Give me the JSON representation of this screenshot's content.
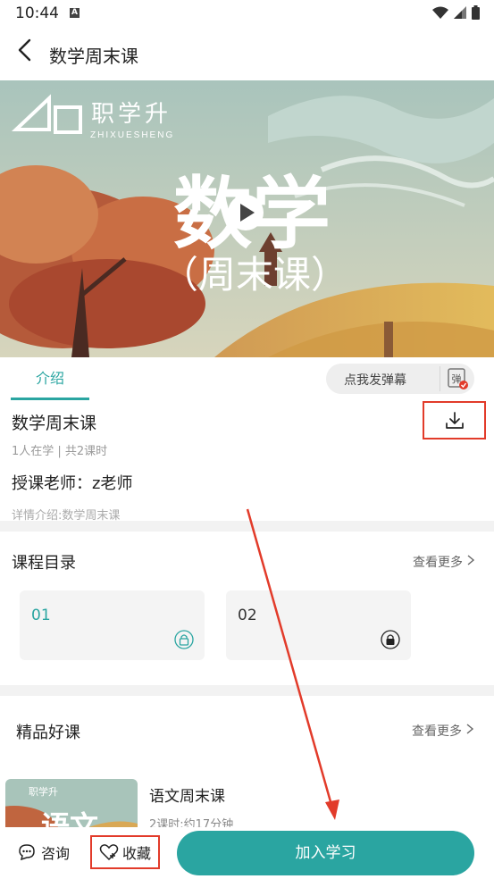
{
  "status_bar": {
    "time": "10:44",
    "notification_letter": "A"
  },
  "header": {
    "title": "数学周末课"
  },
  "banner": {
    "brand_name": "职学升",
    "brand_pinyin": "ZHIXUESHENG",
    "main_title": "数学",
    "sub_title": "（周末课）"
  },
  "tabs": {
    "intro_label": "介绍",
    "danmu_label": "点我发弹幕",
    "danmu_icon_char": "弹"
  },
  "course": {
    "title": "数学周末课",
    "meta": "1人在学 | 共2课时",
    "teacher": "授课老师：z老师",
    "detail": "详情介绍:数学周末课"
  },
  "catalog": {
    "title": "课程目录",
    "more_label": "查看更多",
    "lessons": [
      {
        "number": "01",
        "color": "#2aa5a1"
      },
      {
        "number": "02",
        "color": "#333333"
      }
    ]
  },
  "quality": {
    "title": "精品好课",
    "more_label": "查看更多",
    "item": {
      "title": "语文周末课",
      "meta": "2课时:约17分钟",
      "thumb_brand": "职学升",
      "thumb_text": "语文"
    }
  },
  "bottom_bar": {
    "consult_label": "咨询",
    "favorite_label": "收藏",
    "join_label": "加入学习"
  },
  "colors": {
    "accent": "#2aa5a1",
    "highlight": "#e23b2a"
  },
  "icons": [
    "back-arrow-icon",
    "download-icon",
    "lock-icon",
    "chat-icon",
    "heart-icon",
    "wifi-icon",
    "signal-icon",
    "battery-icon"
  ]
}
